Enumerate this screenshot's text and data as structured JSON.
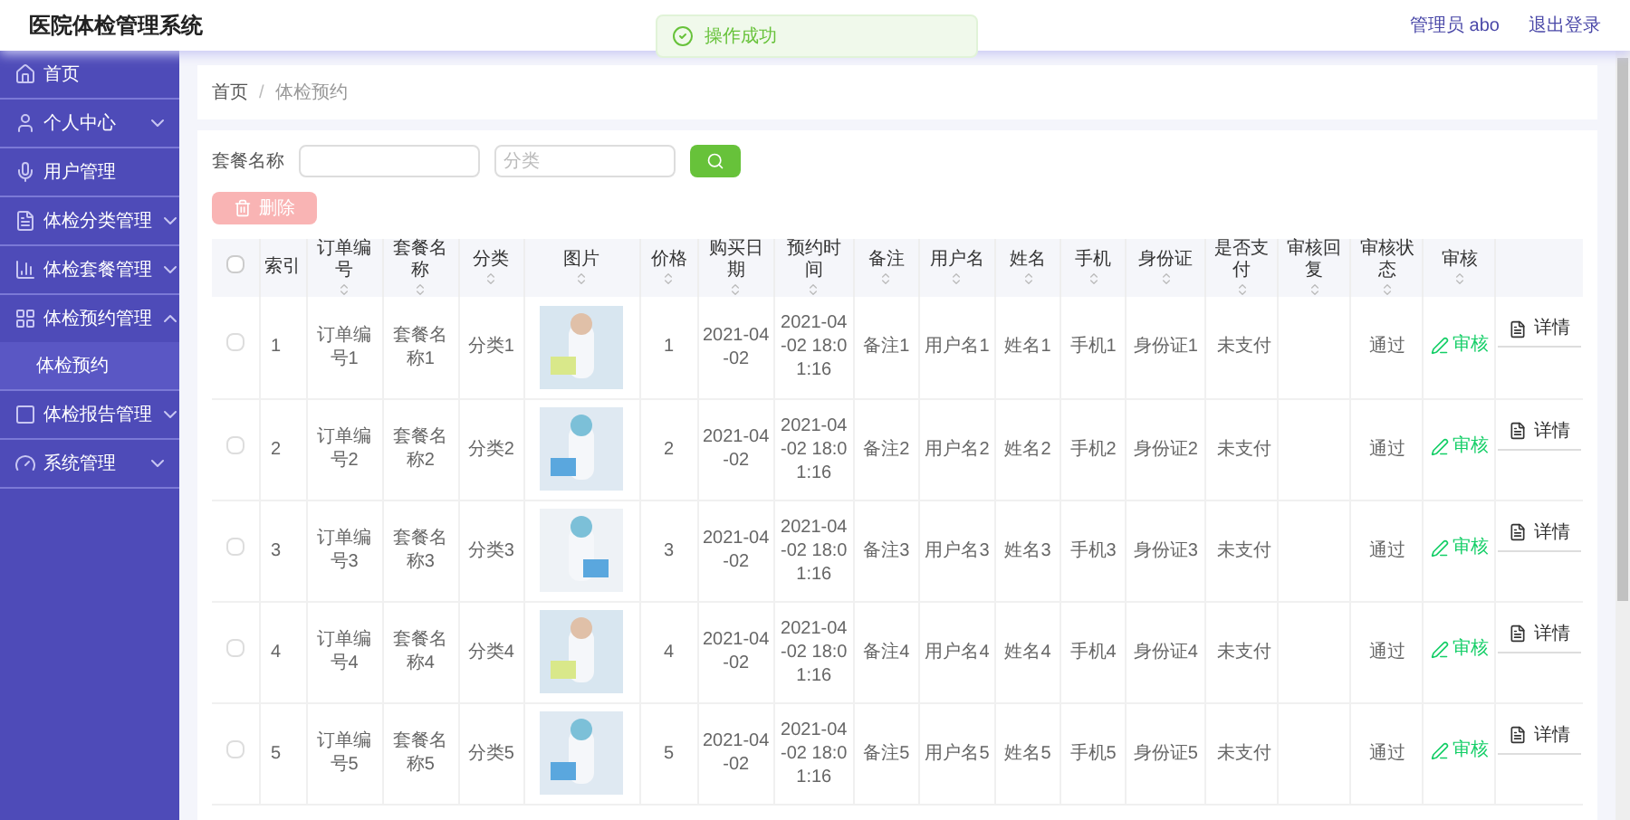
{
  "app_title": "医院体检管理系统",
  "toast": {
    "text": "操作成功"
  },
  "user": {
    "role_label": "管理员 abo",
    "logout": "退出登录"
  },
  "sidebar": {
    "items": [
      {
        "label": "首页",
        "expandable": false
      },
      {
        "label": "个人中心",
        "expandable": true,
        "expanded": false
      },
      {
        "label": "用户管理",
        "expandable": false
      },
      {
        "label": "体检分类管理",
        "expandable": true,
        "expanded": false
      },
      {
        "label": "体检套餐管理",
        "expandable": true,
        "expanded": false
      },
      {
        "label": "体检预约管理",
        "expandable": true,
        "expanded": true,
        "children": [
          {
            "label": "体检预约",
            "selected": true
          }
        ]
      },
      {
        "label": "体检报告管理",
        "expandable": true,
        "expanded": false
      },
      {
        "label": "系统管理",
        "expandable": true,
        "expanded": false
      }
    ]
  },
  "breadcrumb": {
    "items": [
      "首页",
      "体检预约"
    ],
    "separator": "/"
  },
  "search": {
    "fields": [
      {
        "label": "套餐名称"
      },
      {
        "placeholder": "分类"
      }
    ]
  },
  "delete_button": {
    "label": "删除",
    "disabled": true
  },
  "table": {
    "header_checked": false,
    "columns": [
      {
        "label": "索引",
        "sortable": false
      },
      {
        "label": "订单编号",
        "sortable": true
      },
      {
        "label": "套餐名称",
        "sortable": true
      },
      {
        "label": "分类",
        "sortable": true
      },
      {
        "label": "图片",
        "sortable": true
      },
      {
        "label": "价格",
        "sortable": true
      },
      {
        "label": "购买日期",
        "sortable": true
      },
      {
        "label": "预约时间",
        "sortable": true
      },
      {
        "label": "备注",
        "sortable": true
      },
      {
        "label": "用户名",
        "sortable": true
      },
      {
        "label": "姓名",
        "sortable": true
      },
      {
        "label": "手机",
        "sortable": true
      },
      {
        "label": "身份证",
        "sortable": true
      },
      {
        "label": "是否支付",
        "sortable": true
      },
      {
        "label": "审核回复",
        "sortable": true
      },
      {
        "label": "审核状态",
        "sortable": true
      },
      {
        "label": "审核",
        "sortable": true
      }
    ],
    "rows": [
      {
        "checked": false,
        "cells": [
          "1",
          "订单编号1",
          "套餐名称1",
          "分类1",
          null,
          "1",
          "2021-04-02",
          "2021-04-02 18:01:16",
          "备注1",
          "用户名1",
          "姓名1",
          "手机1",
          "身份证1",
          "未支付",
          null,
          "通过"
        ],
        "audit": "审核",
        "details": "详情"
      },
      {
        "checked": false,
        "cells": [
          "2",
          "订单编号2",
          "套餐名称2",
          "分类2",
          null,
          "2",
          "2021-04-02",
          "2021-04-02 18:01:16",
          "备注2",
          "用户名2",
          "姓名2",
          "手机2",
          "身份证2",
          "未支付",
          null,
          "通过"
        ],
        "audit": "审核",
        "details": "详情"
      },
      {
        "checked": false,
        "cells": [
          "3",
          "订单编号3",
          "套餐名称3",
          "分类3",
          null,
          "3",
          "2021-04-02",
          "2021-04-02 18:01:16",
          "备注3",
          "用户名3",
          "姓名3",
          "手机3",
          "身份证3",
          "未支付",
          null,
          "通过"
        ],
        "audit": "审核",
        "details": "详情"
      },
      {
        "checked": false,
        "cells": [
          "4",
          "订单编号4",
          "套餐名称4",
          "分类4",
          null,
          "4",
          "2021-04-02",
          "2021-04-02 18:01:16",
          "备注4",
          "用户名4",
          "姓名4",
          "手机4",
          "身份证4",
          "未支付",
          null,
          "通过"
        ],
        "audit": "审核",
        "details": "详情"
      },
      {
        "checked": false,
        "cells": [
          "5",
          "订单编号5",
          "套餐名称5",
          "分类5",
          null,
          "5",
          "2021-04-02",
          "2021-04-02 18:01:16",
          "备注5",
          "用户名5",
          "姓名5",
          "手机5",
          "身份证5",
          "未支付",
          null,
          "通过"
        ],
        "audit": "审核",
        "details": "详情"
      }
    ]
  }
}
